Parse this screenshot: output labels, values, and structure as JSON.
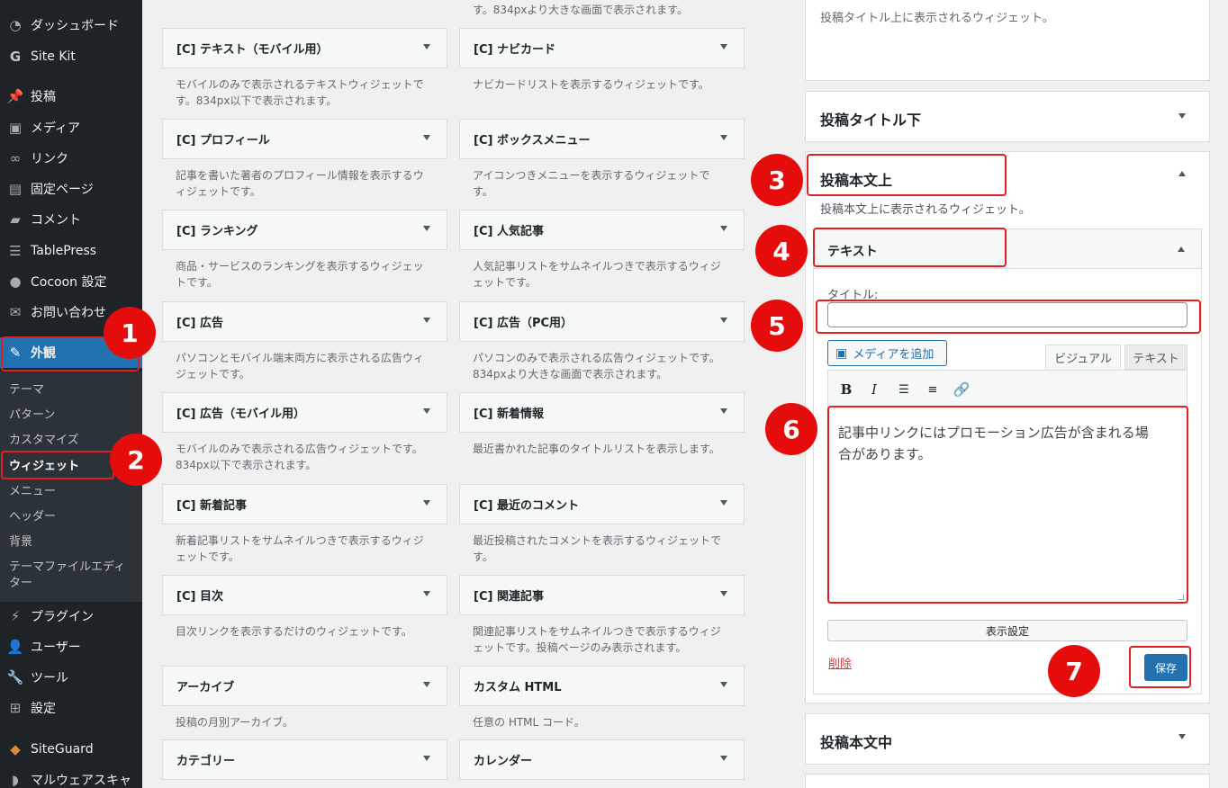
{
  "sidebar": {
    "items": [
      {
        "label": "ダッシュボード",
        "icon": "dashboard-icon"
      },
      {
        "label": "Site Kit",
        "icon": "sitekit-icon"
      },
      {
        "label": "投稿",
        "icon": "pin-icon"
      },
      {
        "label": "メディア",
        "icon": "media-icon"
      },
      {
        "label": "リンク",
        "icon": "link-icon"
      },
      {
        "label": "固定ページ",
        "icon": "page-icon"
      },
      {
        "label": "コメント",
        "icon": "comment-icon"
      },
      {
        "label": "TablePress",
        "icon": "table-icon"
      },
      {
        "label": "Cocoon 設定",
        "icon": "cocoon-icon"
      },
      {
        "label": "お問い合わせ",
        "icon": "mail-icon"
      },
      {
        "label": "外観",
        "icon": "appearance-icon"
      },
      {
        "label": "プラグイン",
        "icon": "plugin-icon"
      },
      {
        "label": "ユーザー",
        "icon": "user-icon"
      },
      {
        "label": "ツール",
        "icon": "tool-icon"
      },
      {
        "label": "設定",
        "icon": "settings-icon"
      },
      {
        "label": "SiteGuard",
        "icon": "siteguard-icon"
      },
      {
        "label": "マルウェアスキャ",
        "icon": "shield-icon"
      }
    ],
    "submenu": [
      "テーマ",
      "パターン",
      "カスタマイズ",
      "ウィジェット",
      "メニュー",
      "ヘッダー",
      "背景",
      "テーマファイルエディ",
      "ター"
    ]
  },
  "widgets": {
    "top_desc": "す。834pxより大きな画面で表示されます。",
    "items": [
      {
        "title": "[C] テキスト（モバイル用）",
        "desc": [
          "モバイルのみで表示されるテキストウィジェットで",
          "す。834px以下で表示されます。"
        ]
      },
      {
        "title": "[C] ナビカード",
        "desc": [
          "ナビカードリストを表示するウィジェットです。"
        ]
      },
      {
        "title": "[C] プロフィール",
        "desc": [
          "記事を書いた著者のプロフィール情報を表示するウ",
          "ィジェットです。"
        ]
      },
      {
        "title": "[C] ボックスメニュー",
        "desc": [
          "アイコンつきメニューを表示するウィジェットで",
          "す。"
        ]
      },
      {
        "title": "[C] ランキング",
        "desc": [
          "商品・サービスのランキングを表示するウィジェッ",
          "トです。"
        ]
      },
      {
        "title": "[C] 人気記事",
        "desc": [
          "人気記事リストをサムネイルつきで表示するウィジ",
          "ェットです。"
        ]
      },
      {
        "title": "[C] 広告",
        "desc": [
          "パソコンとモバイル端末両方に表示される広告ウィ",
          "ジェットです。"
        ]
      },
      {
        "title": "[C] 広告（PC用）",
        "desc": [
          "パソコンのみで表示される広告ウィジェットです。",
          "834pxより大きな画面で表示されます。"
        ]
      },
      {
        "title": "[C] 広告（モバイル用）",
        "desc": [
          "モバイルのみで表示される広告ウィジェットです。",
          "834px以下で表示されます。"
        ]
      },
      {
        "title": "[C] 新着情報",
        "desc": [
          "最近書かれた記事のタイトルリストを表示します。"
        ]
      },
      {
        "title": "[C] 新着記事",
        "desc": [
          "新着記事リストをサムネイルつきで表示するウィジ",
          "ェットです。"
        ]
      },
      {
        "title": "[C] 最近のコメント",
        "desc": [
          "最近投稿されたコメントを表示するウィジェットで",
          "す。"
        ]
      },
      {
        "title": "[C] 目次",
        "desc": [
          "目次リンクを表示するだけのウィジェットです。"
        ]
      },
      {
        "title": "[C] 関連記事",
        "desc": [
          "関連記事リストをサムネイルつきで表示するウィジ",
          "ェットです。投稿ページのみ表示されます。"
        ]
      },
      {
        "title": "アーカイブ",
        "desc": [
          "投稿の月別アーカイブ。"
        ]
      },
      {
        "title": "カスタム HTML",
        "desc": [
          "任意の HTML コード。"
        ]
      },
      {
        "title": "カテゴリー",
        "desc": []
      },
      {
        "title": "カレンダー",
        "desc": []
      }
    ]
  },
  "areas": {
    "top_desc": "投稿タイトル上に表示されるウィジェット。",
    "post_title_below": "投稿タイトル下",
    "post_body_top": "投稿本文上",
    "post_body_top_desc": "投稿本文上に表示されるウィジェット。",
    "post_body_mid": "投稿本文中"
  },
  "text_widget": {
    "header": "テキスト",
    "title_label": "タイトル:",
    "title_value": "",
    "media_button": "メディアを追加",
    "tab_visual": "ビジュアル",
    "tab_text": "テキスト",
    "content_line1": "記事中リンクにはプロモーション広告が含まれる場",
    "content_line2": "合があります。",
    "display_settings": "表示設定",
    "delete": "削除",
    "save": "保存"
  },
  "annotations": [
    "1",
    "2",
    "3",
    "4",
    "5",
    "6",
    "7"
  ],
  "colors": {
    "accent": "#2271b1",
    "sidebar_bg": "#1d2327",
    "annotation_red": "#e50c0c"
  }
}
